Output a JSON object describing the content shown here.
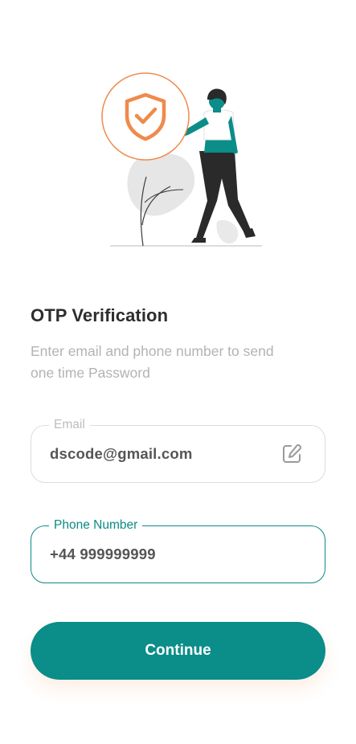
{
  "illustration": {
    "shield_icon": "shield-check-icon",
    "colors": {
      "accent": "#f08a4b",
      "teal": "#0b8d89",
      "dark": "#2a2a2a",
      "plant": "#e6e6e6"
    }
  },
  "header": {
    "title": "OTP Verification",
    "subtitle": "Enter email and phone number to send one time Password"
  },
  "form": {
    "email": {
      "label": "Email",
      "value": "dscode@gmail.com",
      "icon": "edit-icon"
    },
    "phone": {
      "label": "Phone Number",
      "value": "+44 999999999"
    }
  },
  "actions": {
    "continue_label": "Continue"
  },
  "colors": {
    "primary": "#0b8d89",
    "border_inactive": "#dcdcdc",
    "text_muted": "#b3b3b3"
  }
}
